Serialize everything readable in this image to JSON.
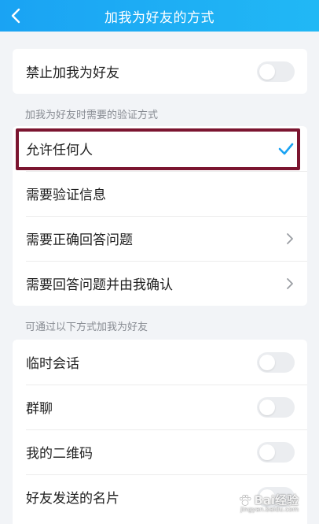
{
  "header": {
    "title": "加我为好友的方式",
    "back_icon": "chevron-left-icon",
    "background": "#1aa3f3"
  },
  "block_section": {
    "items": [
      {
        "label": "禁止加我为好友",
        "toggle_on": false
      }
    ]
  },
  "verify_section": {
    "label": "加我为好友时需要的验证方式",
    "selected_index": 0,
    "items": [
      {
        "label": "允许任何人",
        "trailing": "check-icon"
      },
      {
        "label": "需要验证信息",
        "trailing": "none"
      },
      {
        "label": "需要正确回答问题",
        "trailing": "chevron-right-icon"
      },
      {
        "label": "需要回答问题并由我确认",
        "trailing": "chevron-right-icon"
      }
    ],
    "accent": "#1aa3f3",
    "highlight_color": "#7b1530"
  },
  "source_section": {
    "label": "可通过以下方式加我为好友",
    "items": [
      {
        "label": "临时会话",
        "toggle_on": false
      },
      {
        "label": "群聊",
        "toggle_on": false
      },
      {
        "label": "我的二维码",
        "toggle_on": false
      },
      {
        "label": "好友发送的名片",
        "toggle_on": false
      }
    ]
  },
  "watermark": {
    "text": "Bai经验",
    "sub": "jingyan.baidu.com"
  }
}
